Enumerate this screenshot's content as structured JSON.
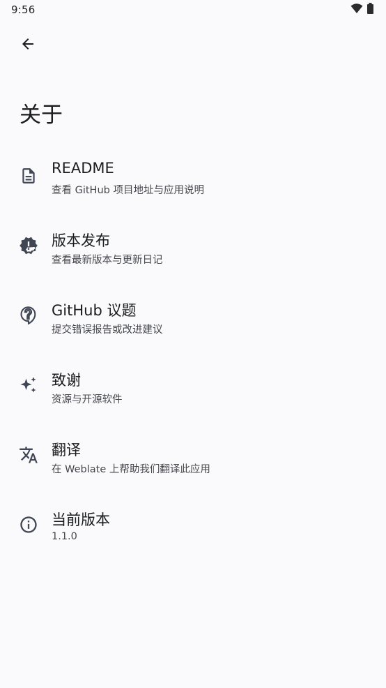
{
  "status_bar": {
    "time": "9:56",
    "icons": [
      "wifi-icon",
      "battery-icon"
    ]
  },
  "toolbar": {
    "back_icon": "arrow-back-icon"
  },
  "page": {
    "title": "关于"
  },
  "items": [
    {
      "icon": "description-icon",
      "title": "README",
      "subtitle": "查看 GitHub 项目地址与应用说明"
    },
    {
      "icon": "new-releases-icon",
      "title": "版本发布",
      "subtitle": "查看最新版本与更新日记"
    },
    {
      "icon": "help-bubble-icon",
      "title": "GitHub 议题",
      "subtitle": "提交错误报告或改进建议"
    },
    {
      "icon": "sparkle-icon",
      "title": "致谢",
      "subtitle": "资源与开源软件"
    },
    {
      "icon": "translate-icon",
      "title": "翻译",
      "subtitle": "在 Weblate 上帮助我们翻译此应用"
    },
    {
      "icon": "info-icon",
      "title": "当前版本",
      "subtitle": "1.1.0"
    }
  ],
  "colors": {
    "background": "#fafafd",
    "text_primary": "#1b1c1f",
    "text_secondary": "#45474d",
    "icon": "#404654"
  }
}
